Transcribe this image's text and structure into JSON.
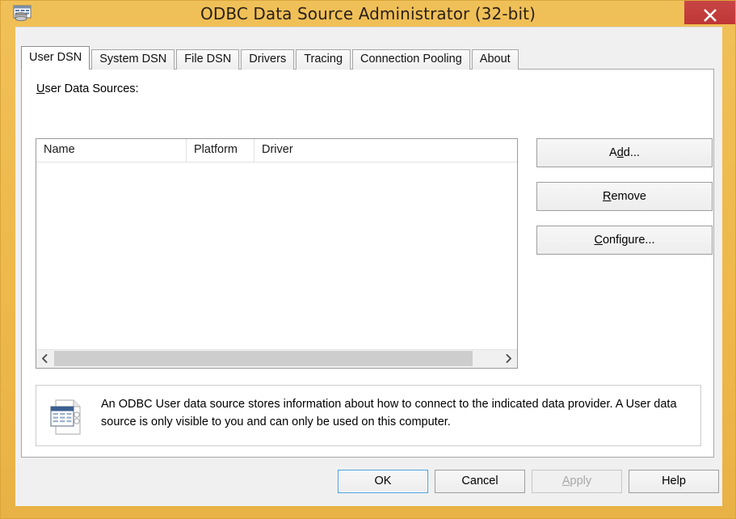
{
  "window": {
    "title": "ODBC Data Source Administrator (32-bit)",
    "icon": "odbc-app-icon",
    "frame_color": "#eeb84a",
    "close_button": {
      "icon": "close-icon",
      "label": "X",
      "color": "#c43c3c"
    }
  },
  "tabs": [
    {
      "label": "User DSN",
      "active": true
    },
    {
      "label": "System DSN",
      "active": false
    },
    {
      "label": "File DSN",
      "active": false
    },
    {
      "label": "Drivers",
      "active": false
    },
    {
      "label": "Tracing",
      "active": false
    },
    {
      "label": "Connection Pooling",
      "active": false
    },
    {
      "label": "About",
      "active": false
    }
  ],
  "user_dsn_panel": {
    "list_label": {
      "accelerator": "U",
      "rest": "ser Data Sources:"
    },
    "columns": [
      {
        "label": "Name"
      },
      {
        "label": "Platform"
      },
      {
        "label": "Driver"
      }
    ],
    "rows": [],
    "scrollbar": {
      "left_arrow_icon": "chevron-left-icon",
      "right_arrow_icon": "chevron-right-icon"
    },
    "side_buttons": [
      {
        "accelerator_before": "A",
        "accelerator": "d",
        "accelerator_after": "d...",
        "label": "Add..."
      },
      {
        "accelerator_before": "",
        "accelerator": "R",
        "accelerator_after": "emove",
        "label": "Remove"
      },
      {
        "accelerator_before": "",
        "accelerator": "C",
        "accelerator_after": "onfigure...",
        "label": "Configure..."
      }
    ],
    "description": {
      "icon": "data-source-document-icon",
      "line1": "An ODBC User data source stores information about how to connect to the indicated data provider.   A",
      "line2": "User data source is only visible to you and can only be used on this computer."
    }
  },
  "dialog_buttons": [
    {
      "label": "OK",
      "enabled": true,
      "default": true
    },
    {
      "label": "Cancel",
      "enabled": true,
      "default": false
    },
    {
      "label": "Apply",
      "enabled": false,
      "default": false,
      "accelerator": "A",
      "accelerator_rest": "pply"
    },
    {
      "label": "Help",
      "enabled": true,
      "default": false
    }
  ]
}
